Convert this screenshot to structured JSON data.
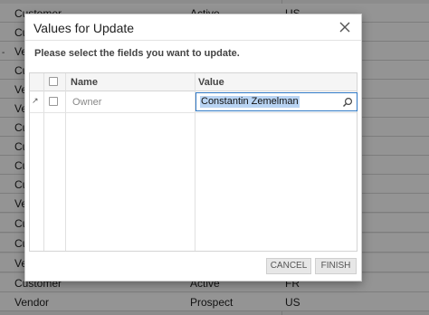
{
  "background_list": {
    "rows": [
      {
        "c1": "Customer",
        "c2": "Active",
        "c3": "US"
      },
      {
        "c1": "Cu",
        "c2": "",
        "c3": ""
      },
      {
        "c1": "Ven",
        "c2": "",
        "c3": ""
      },
      {
        "c1": "Cu",
        "c2": "",
        "c3": ""
      },
      {
        "c1": "Ve",
        "c2": "",
        "c3": ""
      },
      {
        "c1": "Ve",
        "c2": "",
        "c3": ""
      },
      {
        "c1": "Cu",
        "c2": "",
        "c3": ""
      },
      {
        "c1": "Cu",
        "c2": "",
        "c3": ""
      },
      {
        "c1": "Cu",
        "c2": "",
        "c3": ""
      },
      {
        "c1": "Cu",
        "c2": "",
        "c3": ""
      },
      {
        "c1": "Ve",
        "c2": "",
        "c3": ""
      },
      {
        "c1": "Cu",
        "c2": "",
        "c3": ""
      },
      {
        "c1": "Cu",
        "c2": "",
        "c3": ""
      },
      {
        "c1": "Ve",
        "c2": "",
        "c3": ""
      },
      {
        "c1": "Customer",
        "c2": "Active",
        "c3": "FR"
      },
      {
        "c1": "Vendor",
        "c2": "Prospect",
        "c3": "US"
      }
    ],
    "side_mark": "-"
  },
  "dialog": {
    "title": "Values for Update",
    "instruction": "Please select the fields you want to update.",
    "grid": {
      "col_name": "Name",
      "col_value": "Value",
      "rows": [
        {
          "name": "Owner",
          "value": "Constantin Zemelman",
          "checked": false
        }
      ]
    },
    "buttons": {
      "cancel": "CANCEL",
      "finish": "FINISH"
    }
  },
  "icons": {
    "close": "close-icon",
    "search": "search-icon",
    "row_pointer": "row-pointer-icon"
  },
  "colors": {
    "input_border": "#2f78c4",
    "selection": "#b9d4f3"
  }
}
